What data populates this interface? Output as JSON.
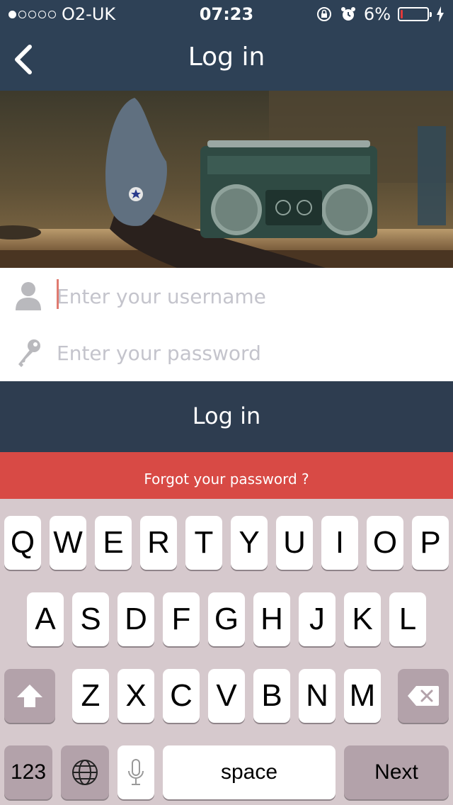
{
  "status_bar": {
    "carrier": "O2-UK",
    "time": "07:23",
    "battery_percent": "6%",
    "battery_level": 0.06,
    "signal_bars_filled": 1,
    "signal_bars_total": 5
  },
  "nav": {
    "title": "Log in",
    "back_icon": "chevron-left-icon"
  },
  "form": {
    "username_placeholder": "Enter your username",
    "password_placeholder": "Enter your password",
    "username_icon": "user-icon",
    "password_icon": "key-icon"
  },
  "buttons": {
    "login_label": "Log in",
    "forgot_label": "Forgot your password ?"
  },
  "keyboard": {
    "row1": [
      "Q",
      "W",
      "E",
      "R",
      "T",
      "Y",
      "U",
      "I",
      "O",
      "P"
    ],
    "row2": [
      "A",
      "S",
      "D",
      "F",
      "G",
      "H",
      "J",
      "K",
      "L"
    ],
    "row3": [
      "Z",
      "X",
      "C",
      "V",
      "B",
      "N",
      "M"
    ],
    "numbers_label": "123",
    "space_label": "space",
    "next_label": "Next"
  },
  "colors": {
    "nav_bg": "#2e4156",
    "login_bg": "#2e3d50",
    "forgot_bg": "#d84a45",
    "keyboard_bg": "#d6c9cd"
  }
}
